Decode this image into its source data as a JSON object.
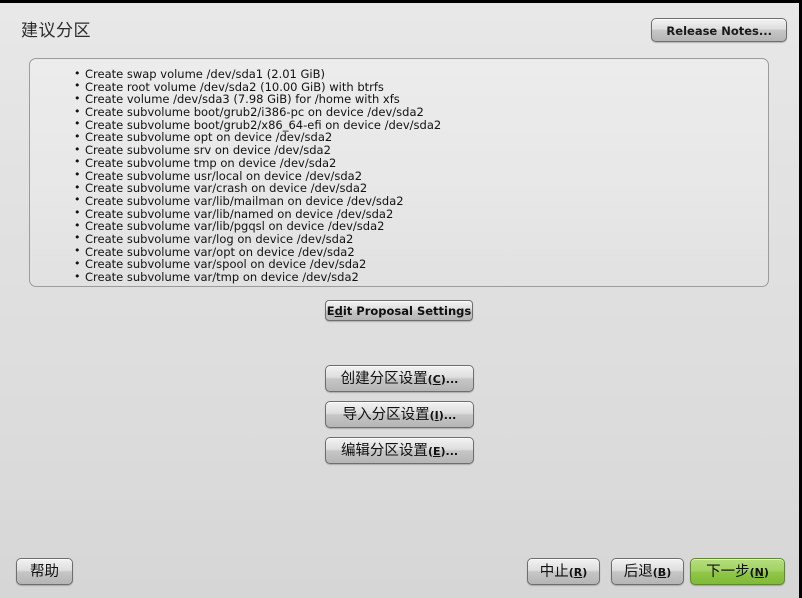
{
  "window": {
    "title": "建议分区"
  },
  "header": {
    "title": "建议分区",
    "release_notes_label": "Release Notes..."
  },
  "proposal": {
    "items": [
      "Create swap volume /dev/sda1 (2.01 GiB)",
      "Create root volume /dev/sda2 (10.00 GiB) with btrfs",
      "Create volume /dev/sda3 (7.98 GiB) for /home with xfs",
      "Create subvolume boot/grub2/i386-pc on device /dev/sda2",
      "Create subvolume boot/grub2/x86_64-efi on device /dev/sda2",
      "Create subvolume opt on device /dev/sda2",
      "Create subvolume srv on device /dev/sda2",
      "Create subvolume tmp on device /dev/sda2",
      "Create subvolume usr/local on device /dev/sda2",
      "Create subvolume var/crash on device /dev/sda2",
      "Create subvolume var/lib/mailman on device /dev/sda2",
      "Create subvolume var/lib/named on device /dev/sda2",
      "Create subvolume var/lib/pgqsl on device /dev/sda2",
      "Create subvolume var/log on device /dev/sda2",
      "Create subvolume var/opt on device /dev/sda2",
      "Create subvolume var/spool on device /dev/sda2",
      "Create subvolume var/tmp on device /dev/sda2"
    ]
  },
  "actions": {
    "edit_proposal_settings": {
      "prefix": "E",
      "accel": "d",
      "suffix": "it Proposal Settings"
    },
    "create_partition_settings": {
      "text": "创建分区设置",
      "accel": "C",
      "suffix": "..."
    },
    "import_partition_settings": {
      "text": "导入分区设置",
      "accel": "I",
      "suffix": "..."
    },
    "edit_partition_settings": {
      "text": "编辑分区设置",
      "accel": "E",
      "suffix": "..."
    }
  },
  "footer": {
    "help_label": "帮助",
    "abort": {
      "text": "中止",
      "accel": "R"
    },
    "back": {
      "text": "后退",
      "accel": "B"
    },
    "next": {
      "text": "下一步",
      "accel": "N"
    }
  },
  "colors": {
    "accent_green": "#8fc646",
    "background": "#e2e2e2",
    "box_border": "#9b9b9b",
    "text": "#111111"
  }
}
